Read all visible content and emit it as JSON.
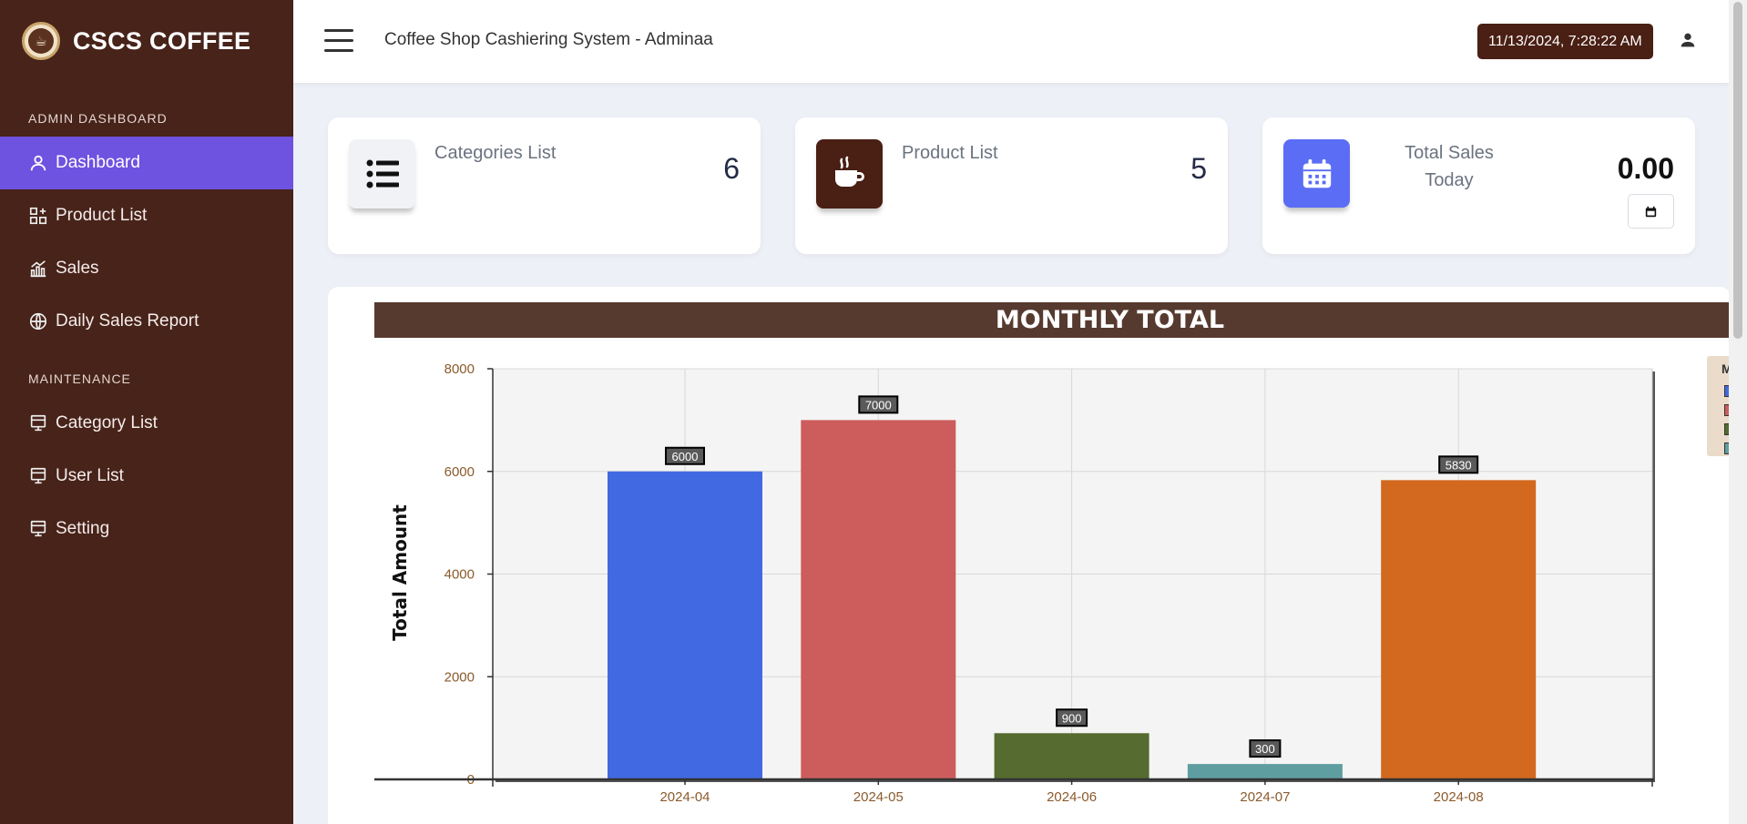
{
  "brand": {
    "name": "CSCS COFFEE",
    "logo_icon": "coffee-cup-logo"
  },
  "sidebar": {
    "section_admin": "ADMIN DASHBOARD",
    "admin_items": [
      {
        "label": "Dashboard",
        "icon": "user-icon",
        "active": true
      },
      {
        "label": "Product List",
        "icon": "grid-icon"
      },
      {
        "label": "Sales",
        "icon": "chart-icon"
      },
      {
        "label": "Daily Sales Report",
        "icon": "globe-icon"
      }
    ],
    "section_maintenance": "MAINTENANCE",
    "maintenance_items": [
      {
        "label": "Category List",
        "icon": "monitor-icon"
      },
      {
        "label": "User List",
        "icon": "monitor-icon"
      },
      {
        "label": "Setting",
        "icon": "monitor-icon"
      }
    ]
  },
  "header": {
    "title": "Coffee Shop Cashiering System - Adminaa",
    "datetime": "11/13/2024, 7:28:22 AM"
  },
  "cards": [
    {
      "label": "Categories List",
      "value": "6",
      "icon": "list-icon",
      "color": "#f1f2f6"
    },
    {
      "label": "Product List",
      "value": "5",
      "icon": "coffee-cup-icon",
      "color": "#4a1f14"
    },
    {
      "label": "Total Sales Today",
      "value": "0.00",
      "icon": "calendar-icon",
      "color": "#5b6df5"
    }
  ],
  "colors": {
    "sidebar_bg": "#47231a",
    "active_nav": "#6e52e0",
    "chart_title_bg": "#573a2f"
  },
  "chart_data": {
    "type": "bar",
    "title": "MONTHLY TOTAL",
    "ylabel": "Total Amount",
    "xlabel": "",
    "categories": [
      "2024-04",
      "2024-05",
      "2024-06",
      "2024-07",
      "2024-08"
    ],
    "values": [
      6000,
      7000,
      900,
      300,
      5830
    ],
    "colors": [
      "#4169e1",
      "#cd5c5c",
      "#556b2f",
      "#5f9ea0",
      "#d2691e"
    ],
    "yticks": [
      0,
      2000,
      4000,
      6000,
      8000
    ],
    "ylim": [
      0,
      8000
    ],
    "grid": true,
    "legend_title": "M",
    "legend_placement": "right"
  }
}
